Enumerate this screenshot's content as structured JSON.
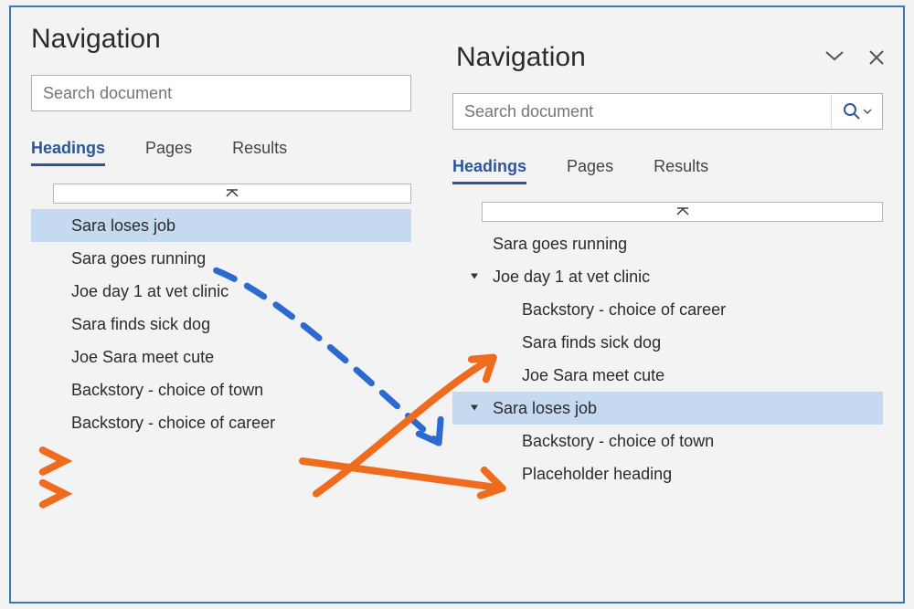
{
  "left": {
    "title": "Navigation",
    "search_placeholder": "Search document",
    "tabs": {
      "headings": "Headings",
      "pages": "Pages",
      "results": "Results"
    },
    "items": [
      {
        "label": "Sara loses job",
        "selected": true
      },
      {
        "label": "Sara goes running",
        "selected": false
      },
      {
        "label": "Joe day 1 at vet clinic",
        "selected": false
      },
      {
        "label": "Sara finds sick dog",
        "selected": false
      },
      {
        "label": "Joe Sara meet cute",
        "selected": false
      },
      {
        "label": "Backstory - choice of town",
        "selected": false
      },
      {
        "label": "Backstory - choice of career",
        "selected": false
      }
    ]
  },
  "right": {
    "title": "Navigation",
    "search_placeholder": "Search document",
    "tabs": {
      "headings": "Headings",
      "pages": "Pages",
      "results": "Results"
    },
    "items": [
      {
        "label": "Sara goes running",
        "level": 1,
        "expandable": false,
        "selected": false
      },
      {
        "label": "Joe day 1 at vet clinic",
        "level": 1,
        "expandable": true,
        "selected": false
      },
      {
        "label": "Backstory - choice of career",
        "level": 2,
        "expandable": false,
        "selected": false
      },
      {
        "label": "Sara finds sick dog",
        "level": 2,
        "expandable": false,
        "selected": false
      },
      {
        "label": "Joe Sara meet cute",
        "level": 2,
        "expandable": false,
        "selected": false
      },
      {
        "label": "Sara loses job",
        "level": 1,
        "expandable": true,
        "selected": true
      },
      {
        "label": "Backstory - choice of town",
        "level": 2,
        "expandable": false,
        "selected": false
      },
      {
        "label": "Placeholder heading",
        "level": 2,
        "expandable": false,
        "selected": false
      }
    ]
  },
  "colors": {
    "accent": "#2b579a",
    "selection": "#c5d9f0",
    "annotation_orange": "#ef6c1f",
    "annotation_blue": "#2b6bd1"
  }
}
